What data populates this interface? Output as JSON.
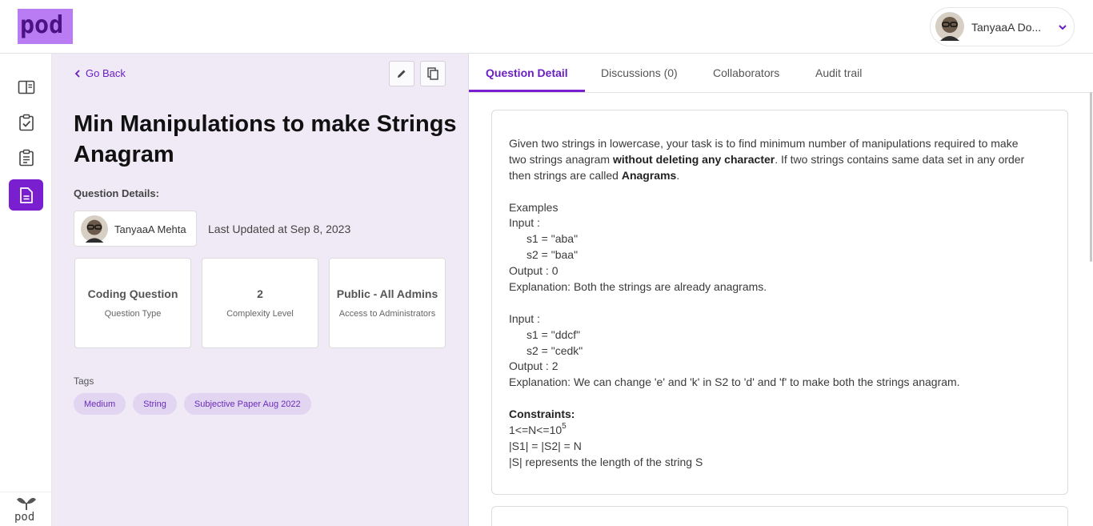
{
  "app": {
    "logo_text": "pod",
    "rail_footer_text": "pod"
  },
  "user": {
    "name": "TanyaaA Do..."
  },
  "sidebar": {
    "items": [
      {
        "icon": "book-open-icon"
      },
      {
        "icon": "clipboard-check-icon"
      },
      {
        "icon": "clipboard-list-icon"
      },
      {
        "icon": "document-icon",
        "active": true
      }
    ]
  },
  "left": {
    "go_back": "Go Back",
    "title": "Min Manipulations to make Strings Anagram",
    "details_label": "Question Details:",
    "author": "TanyaaA Mehta",
    "last_updated": "Last Updated at Sep 8, 2023",
    "cards": [
      {
        "value": "Coding Question",
        "label": "Question Type"
      },
      {
        "value": "2",
        "label": "Complexity Level"
      },
      {
        "value": "Public - All Admins",
        "label": "Access to Administrators"
      }
    ],
    "tags_label": "Tags",
    "tags": [
      "Medium",
      "String",
      "Subjective Paper Aug 2022"
    ]
  },
  "tabs": [
    "Question Detail",
    "Discussions (0)",
    "Collaborators",
    "Audit trail"
  ],
  "desc": {
    "p1a": "Given two strings in lowercase, your task is to find minimum number of manipulations required to make",
    "p1b": "two strings anagram ",
    "p1b_bold": "without deleting any character",
    "p1b_rest": ". If two strings contains same data set in any order",
    "p1c": "then strings are called ",
    "p1c_bold": "Anagrams",
    "p1c_rest": ".",
    "examples": "Examples",
    "input1": "Input :",
    "s1a": "s1 = \"aba\"",
    "s2a": "s2 = \"baa\"",
    "out1": "Output : 0",
    "exp1": "Explanation: Both the strings are already anagrams.",
    "input2": "Input :",
    "s1b": "s1 = \"ddcf\"",
    "s2b": "s2 = \"cedk\"",
    "out2": "Output : 2",
    "exp2": "Explanation: We can change 'e' and 'k' in S2 to 'd' and 'f' to make both the strings anagram.",
    "constraints": "Constraints:",
    "c1": "1<=N<=10",
    "c1_sup": "5",
    "c2": "|S1| = |S2| = N",
    "c3": "|S| represents the length of the string S"
  },
  "colors": {
    "accent": "#7a1fd0",
    "panel_bg": "#efeaf6",
    "tag_bg": "#e2d5f2"
  }
}
